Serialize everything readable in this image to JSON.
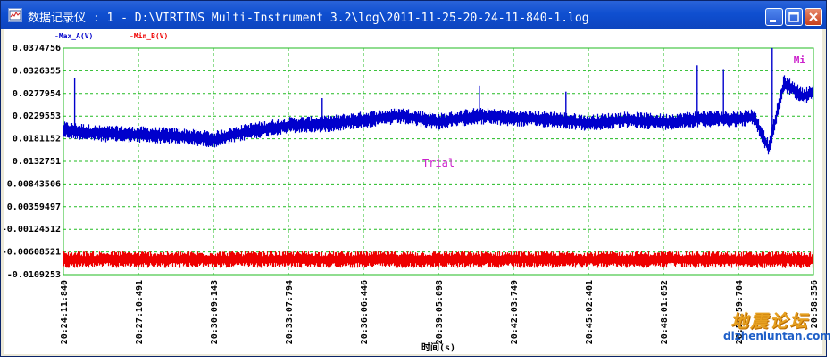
{
  "window": {
    "title": "数据记录仪 : 1 - D:\\VIRTINS Multi-Instrument 3.2\\log\\2011-11-25-20-24-11-840-1.log",
    "buttons": {
      "minimize": "minimize",
      "maximize": "maximize",
      "close": "close"
    }
  },
  "chart": {
    "legend": [
      {
        "label": "-Max_A(V)",
        "color": "#0000cc"
      },
      {
        "label": "-Min_B(V)",
        "color": "#ee0000"
      }
    ],
    "corner_label": "Mi",
    "trial_label": "Trial",
    "xlabel": "时间(s)",
    "grid_color": "#22bb22"
  },
  "chart_data": {
    "type": "line",
    "ylim": [
      -0.0109253,
      0.0374756
    ],
    "yticks": [
      "0.0374756",
      "0.0326355",
      "0.0277954",
      "0.0229553",
      "0.0181152",
      "0.0132751",
      "0.00843506",
      "0.00359497",
      "-0.00124512",
      "-0.00608521",
      "-0.0109253"
    ],
    "xticks": [
      "20:24:11:840",
      "20:27:10:491",
      "20:30:09:143",
      "20:33:07:794",
      "20:36:06:446",
      "20:39:05:098",
      "20:42:03:749",
      "20:45:02:401",
      "20:48:01:052",
      "20:50:59:704",
      "20:58:356"
    ],
    "xlabel": "时间(s)",
    "grid": true,
    "series": [
      {
        "name": "-Max_A(V)",
        "color": "#0000cc",
        "band_halfwidth": 0.0018,
        "x": [
          0,
          0.5,
          1,
          1.5,
          2,
          2.5,
          3,
          3.5,
          4,
          4.5,
          5,
          5.5,
          6,
          6.5,
          7,
          7.5,
          8,
          8.5,
          9,
          9.2,
          9.4,
          9.6,
          9.7,
          9.85,
          10
        ],
        "values": [
          0.02,
          0.0192,
          0.019,
          0.0187,
          0.018,
          0.0198,
          0.021,
          0.0213,
          0.0222,
          0.023,
          0.0218,
          0.023,
          0.0225,
          0.0223,
          0.0215,
          0.0222,
          0.0217,
          0.0224,
          0.0224,
          0.0228,
          0.016,
          0.03,
          0.029,
          0.0272,
          0.028
        ],
        "spikes": [
          {
            "x": 0.15,
            "value": 0.031
          },
          {
            "x": 3.45,
            "value": 0.0268
          },
          {
            "x": 5.55,
            "value": 0.0295
          },
          {
            "x": 6.7,
            "value": 0.0282
          },
          {
            "x": 8.45,
            "value": 0.0338
          },
          {
            "x": 8.8,
            "value": 0.033
          },
          {
            "x": 9.45,
            "value": 0.0375
          }
        ]
      },
      {
        "name": "-Min_B(V)",
        "color": "#ee0000",
        "band_halfwidth": 0.0018,
        "x": [
          0,
          2,
          4,
          6,
          8,
          10
        ],
        "values": [
          -0.0077,
          -0.0077,
          -0.0077,
          -0.0077,
          -0.0077,
          -0.0078
        ],
        "spikes": []
      }
    ]
  },
  "watermark": {
    "title": "地震论坛",
    "url": "dizhenluntan.com"
  }
}
